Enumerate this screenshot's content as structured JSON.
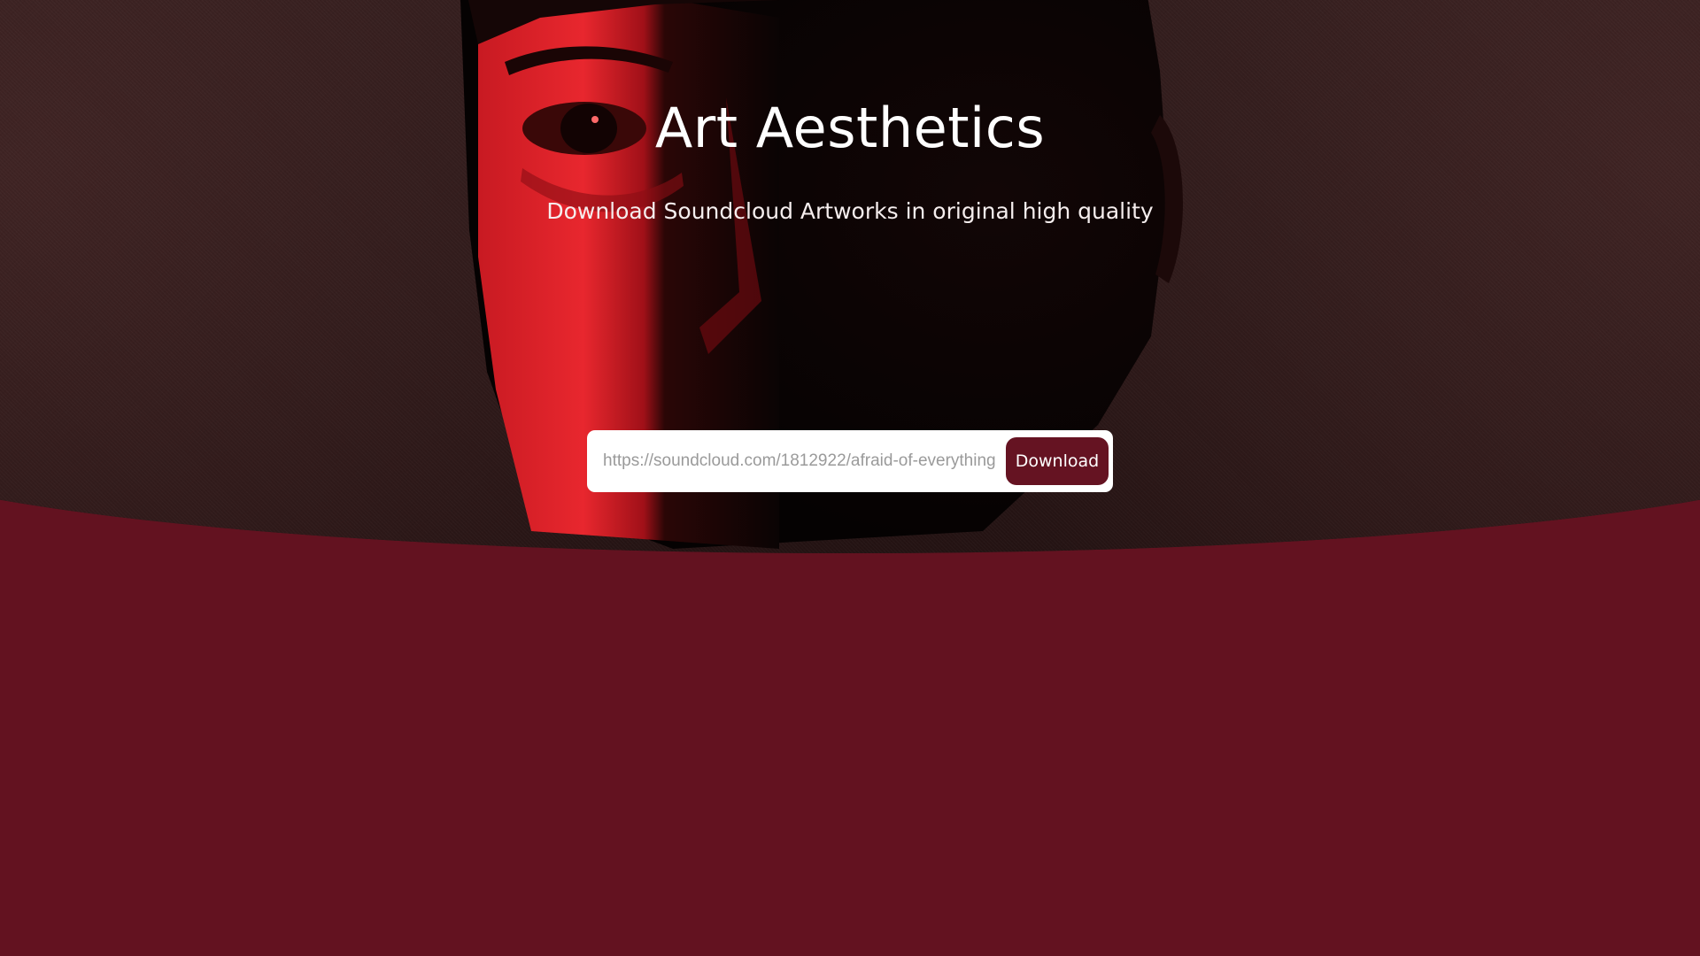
{
  "hero": {
    "title": "Art Aesthetics",
    "subtitle": "Download Soundcloud Artworks in original high quality"
  },
  "search": {
    "placeholder": "https://soundcloud.com/1812922/afraid-of-everything",
    "value": ""
  },
  "download_button": {
    "label": "Download"
  },
  "colors": {
    "background": "#631220",
    "button": "#651322",
    "hero_accent": "#e8232b"
  },
  "icons": {
    "hero_image": "portrait-photo"
  }
}
